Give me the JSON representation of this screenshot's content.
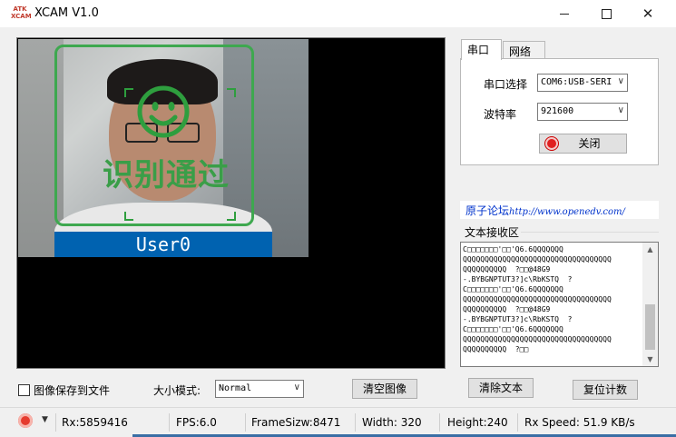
{
  "window": {
    "title": "XCAM V1.0",
    "app_icon_text": "ATK\nXCAM"
  },
  "video": {
    "recognition_text": "识别通过",
    "user_label": "User0"
  },
  "tabs": [
    {
      "label": "串口",
      "active": true
    },
    {
      "label": "网络",
      "active": false
    }
  ],
  "serial": {
    "port_label": "串口选择",
    "port_value": "COM6:USB-SERI",
    "baud_label": "波特率",
    "baud_value": "921600",
    "toggle_label": "关闭"
  },
  "forum": {
    "text": "原子论坛",
    "url": "http://www.openedv.com/"
  },
  "rx": {
    "group_label": "文本接收区",
    "text": "C□□□□□□□'□□'Q6.6QQQQQQQ\nQQQQQQQQQQQQQQQQQQQQQQQQQQQQQQQQQQ\nQQQQQQQQQQ  ?□□@48G9\n-.BYBGNPTUT3?]c\\RbKSTQ  ?\nC□□□□□□□'□□'Q6.6QQQQQQQ\nQQQQQQQQQQQQQQQQQQQQQQQQQQQQQQQQQQ\nQQQQQQQQQQ  ?□□@48G9\n-.BYBGNPTUT3?]c\\RbKSTQ  ?\nC□□□□□□□'□□'Q6.6QQQQQQQ\nQQQQQQQQQQQQQQQQQQQQQQQQQQQQQQQQQQ\nQQQQQQQQQQ  ?□□"
  },
  "bottom": {
    "save_label": "图像保存到文件",
    "save_checked": false,
    "size_mode_label": "大小模式:",
    "size_mode_value": "Normal",
    "clear_image_label": "清空图像",
    "clear_text_label": "清除文本",
    "reset_count_label": "复位计数"
  },
  "status": {
    "rx": "Rx:5859416",
    "fps": "FPS:6.0",
    "frame_size": "FrameSizw:8471",
    "width": "Width:  320",
    "height": "Height:240",
    "rx_speed": "Rx Speed:  51.9 KB/s"
  },
  "colors": {
    "detect_green": "#3ea84f",
    "user_banner_blue": "#0062b0",
    "record_red": "#e02020"
  }
}
